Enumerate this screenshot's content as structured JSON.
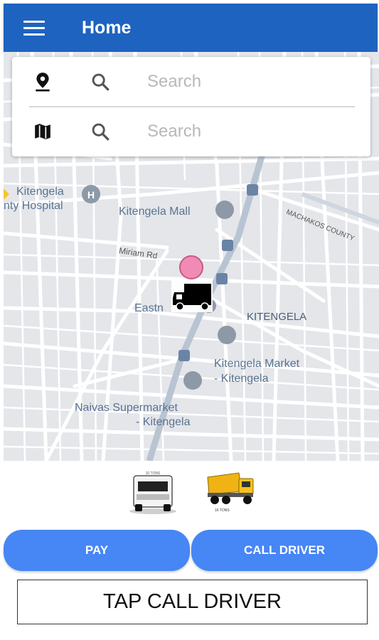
{
  "header": {
    "title": "Home",
    "menu_icon": "menu-icon"
  },
  "search": {
    "origin_placeholder": "Search",
    "destination_placeholder": "Search",
    "origin_icon": "location-pin-icon",
    "destination_icon": "map-icon"
  },
  "map": {
    "labels": {
      "hospital_line1": "Kitengela",
      "hospital_line2": "nty Hospital",
      "mall": "Kitengela Mall",
      "road": "Miriam Rd",
      "eastn": "Eastn",
      "area": "KITENGELA",
      "county": "MACHAKOS COUNTY",
      "market_line1": "Kitengela Market",
      "market_line2": "- Kitengela",
      "naivas_line1": "Naivas Supermarket",
      "naivas_line2": "- Kitengela"
    }
  },
  "vehicles": {
    "small_truck_label": "10 TONS",
    "dump_truck_label": "16 TONS"
  },
  "actions": {
    "pay_label": "PAY",
    "call_label": "CALL DRIVER"
  },
  "status": {
    "message": "TAP CALL DRIVER"
  },
  "colors": {
    "appbar": "#1e63c0",
    "button": "#4786f5",
    "map_bg": "#e4e6ea"
  }
}
